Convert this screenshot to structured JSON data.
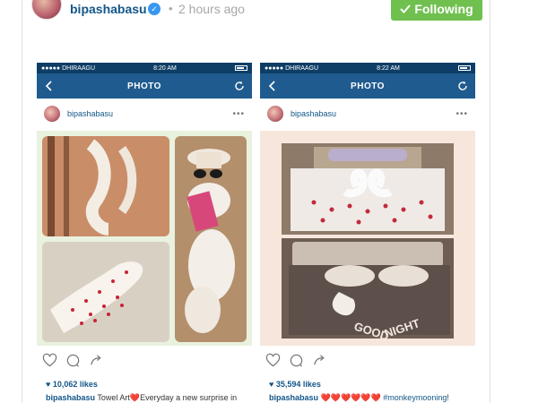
{
  "post": {
    "username": "bipashabasu",
    "separator": "•",
    "time": "2 hours ago",
    "follow_label": "Following"
  },
  "phones": [
    {
      "carrier": "●●●●● DHIRAAGU",
      "time": "8:20 AM",
      "nav_title": "PHOTO",
      "username": "bipashabasu",
      "more": "•••",
      "likes": "10,062 likes",
      "caption_user": "bipashabasu",
      "caption_text": "Towel Art❤️Everyday a new surprise in"
    },
    {
      "carrier": "●●●●● DHIRAAGU",
      "time": "8:22 AM",
      "nav_title": "PHOTO",
      "username": "bipashabasu",
      "more": "•••",
      "likes": "35,594 likes",
      "caption_user": "bipashabasu",
      "caption_hearts": "❤️❤️❤️❤️❤️❤️",
      "caption_tag": "#monkeymooning",
      "caption_end": "!"
    }
  ],
  "colors": {
    "status_bar": "#0e3e66",
    "nav_bar": "#1f5b8e",
    "username_blue": "#125688",
    "follow_green": "#70c050"
  },
  "icons": [
    "checkmark-icon",
    "verified-icon",
    "back-arrow-icon",
    "refresh-icon",
    "wifi-icon",
    "battery-icon",
    "heart-icon",
    "comment-icon",
    "share-icon"
  ]
}
